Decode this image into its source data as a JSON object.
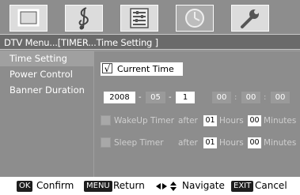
{
  "tabs": [
    {
      "icon": "tv-screen-icon"
    },
    {
      "icon": "music-note-icon"
    },
    {
      "icon": "settings-list-icon"
    },
    {
      "icon": "clock-icon",
      "active": true
    },
    {
      "icon": "wrench-icon"
    }
  ],
  "title": "DTV Menu...[TIMER...Time Setting ]",
  "sidebar": {
    "items": [
      {
        "label": "Time Setting"
      },
      {
        "label": "Power Control"
      },
      {
        "label": "Banner Duration"
      }
    ]
  },
  "current_time": {
    "label": "Current Time",
    "checked": true,
    "check": "√"
  },
  "date": {
    "year": "2008",
    "month": "05",
    "day": "1"
  },
  "time": {
    "hour": "00",
    "minute": "00",
    "second": "00"
  },
  "separators": {
    "date": "-",
    "time": ":"
  },
  "wakeup": {
    "label": "WakeUp Timer",
    "after": "after",
    "hours_value": "01",
    "hours": "Hours",
    "minutes_value": "00",
    "minutes": "Minutes"
  },
  "sleep": {
    "label": "Sleep Timer",
    "after": "after",
    "hours_value": "01",
    "hours": "Hours",
    "minutes_value": "00",
    "minutes": "Minutes"
  },
  "footer": {
    "ok_key": "OK",
    "ok_label": "Confirm",
    "menu_key": "MENU",
    "menu_label": "Return",
    "nav_label": "Navigate",
    "exit_key": "EXIT",
    "exit_label": "Cancel"
  }
}
